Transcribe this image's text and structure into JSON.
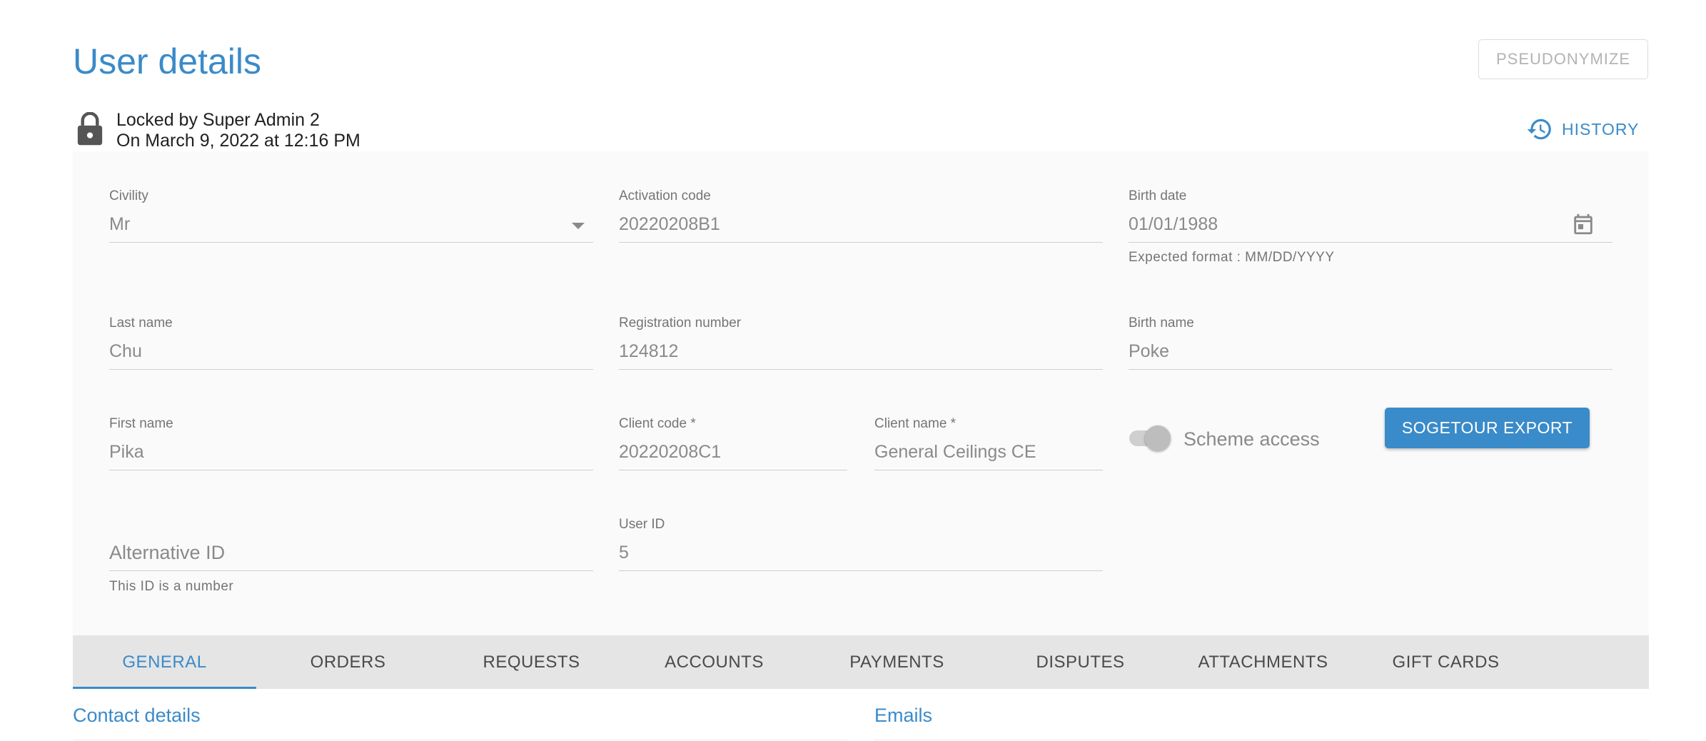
{
  "header": {
    "title": "User details",
    "pseudonymize_label": "PSEUDONYMIZE",
    "lock_line1": "Locked by Super Admin 2",
    "lock_line2": "On March 9, 2022 at 12:16 PM",
    "history_label": "HISTORY"
  },
  "form": {
    "civility": {
      "label": "Civility",
      "value": "Mr"
    },
    "activation_code": {
      "label": "Activation code",
      "value": "20220208B1"
    },
    "birth_date": {
      "label": "Birth date",
      "value": "01/01/1988",
      "helper": "Expected format : MM/DD/YYYY"
    },
    "last_name": {
      "label": "Last name",
      "value": "Chu"
    },
    "registration_number": {
      "label": "Registration number",
      "value": "124812"
    },
    "birth_name": {
      "label": "Birth name",
      "value": "Poke"
    },
    "first_name": {
      "label": "First name",
      "value": "Pika"
    },
    "client_code": {
      "label": "Client code *",
      "value": "20220208C1"
    },
    "client_name": {
      "label": "Client name *",
      "value": "General Ceilings CE"
    },
    "scheme_access": {
      "label": "Scheme access"
    },
    "export_label": "SOGETOUR EXPORT",
    "alternative_id": {
      "placeholder": "Alternative ID",
      "helper": "This ID is a number"
    },
    "user_id": {
      "label": "User ID",
      "value": "5"
    }
  },
  "tabs": [
    {
      "label": "GENERAL"
    },
    {
      "label": "ORDERS"
    },
    {
      "label": "REQUESTS"
    },
    {
      "label": "ACCOUNTS"
    },
    {
      "label": "PAYMENTS"
    },
    {
      "label": "DISPUTES"
    },
    {
      "label": "ATTACHMENTS"
    },
    {
      "label": "GIFT CARDS"
    }
  ],
  "sections": {
    "contact_details": "Contact details",
    "emails": "Emails"
  },
  "colors": {
    "accent": "#3a8bc9",
    "panel_bg": "#fafafa",
    "tab_bar_bg": "#e5e5e5"
  }
}
